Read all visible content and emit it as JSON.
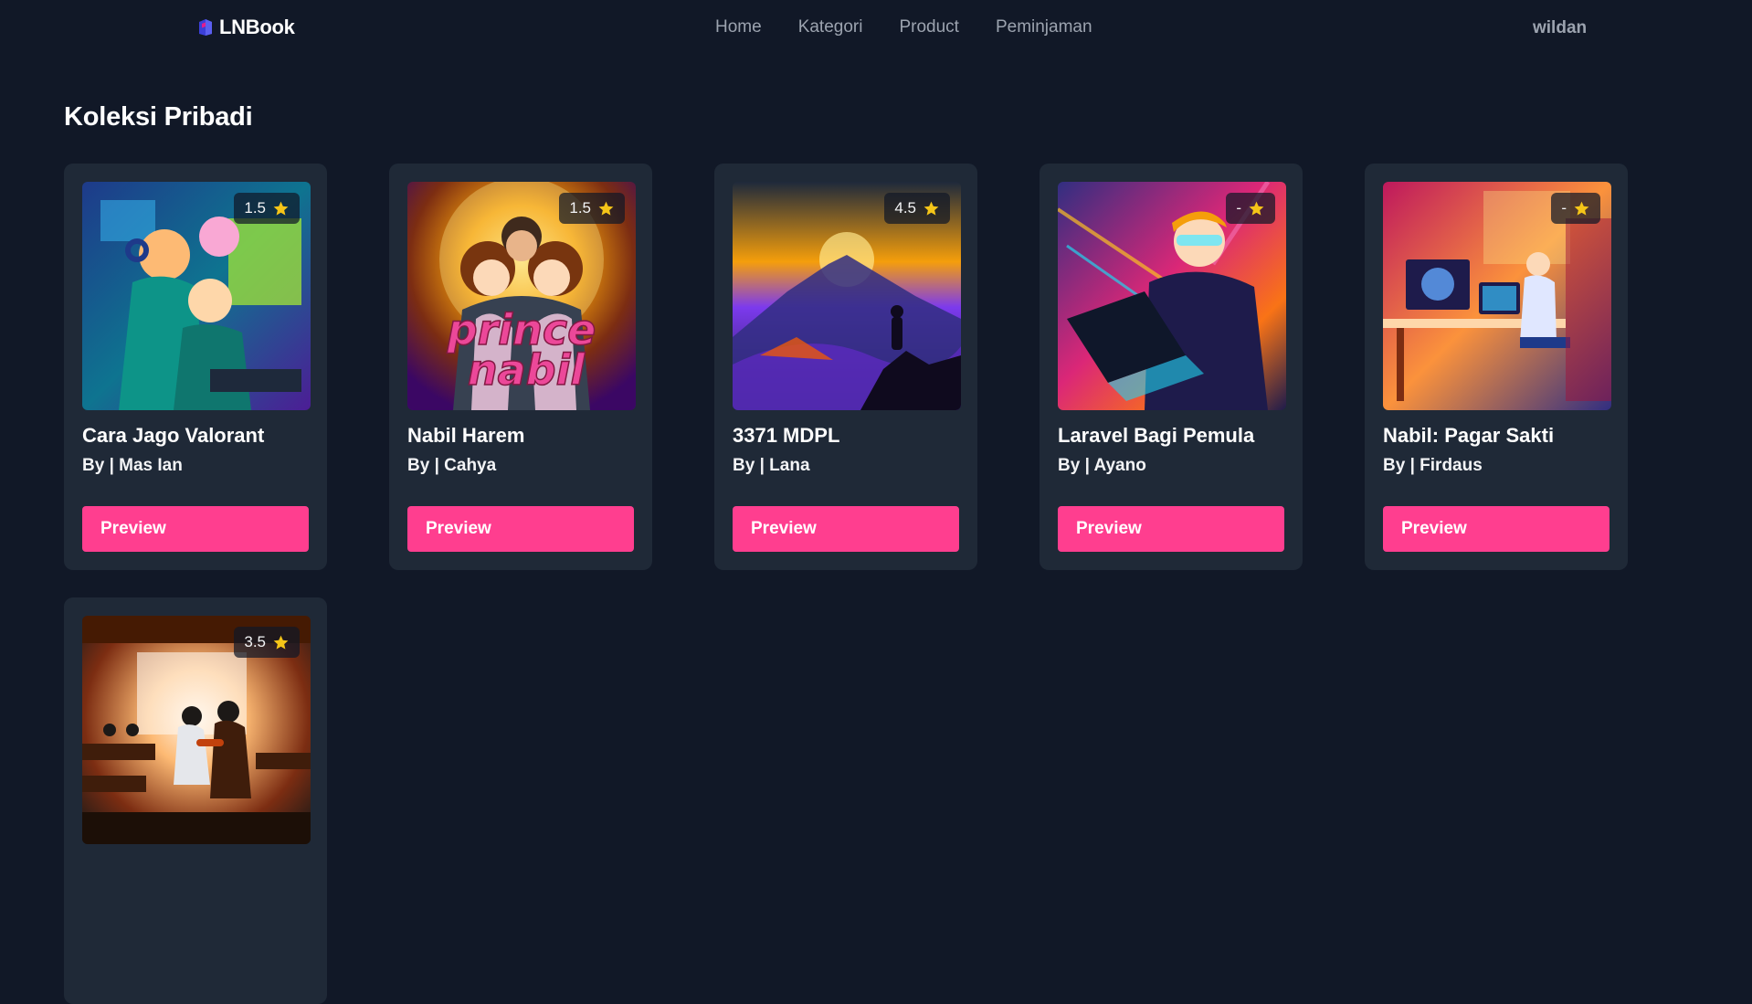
{
  "nav": {
    "brand": "LNBook",
    "links": [
      "Home",
      "Kategori",
      "Product",
      "Peminjaman"
    ],
    "user": "wildan"
  },
  "page": {
    "title": "Koleksi Pribadi"
  },
  "colors": {
    "background": "#111827",
    "card": "#1f2937",
    "accent": "#ff3e8f",
    "star": "#f5c518",
    "muted": "#9ca3af"
  },
  "books": [
    {
      "title": "Cara Jago Valorant",
      "author": "By | Mas Ian",
      "rating": "1.5",
      "button": "Preview",
      "cover": "gamers-at-computers"
    },
    {
      "title": "Nabil Harem",
      "author": "By | Cahya",
      "rating": "1.5",
      "button": "Preview",
      "cover": "romance-prince-nabil",
      "cover_text": [
        "prince",
        "nabil"
      ]
    },
    {
      "title": "3371 MDPL",
      "author": "By | Lana",
      "rating": "4.5",
      "button": "Preview",
      "cover": "mountain-silhouette"
    },
    {
      "title": "Laravel Bagi Pemula",
      "author": "By | Ayano",
      "rating": "-",
      "button": "Preview",
      "cover": "coder-with-laptop"
    },
    {
      "title": "Nabil: Pagar Sakti",
      "author": "By | Firdaus",
      "rating": "-",
      "button": "Preview",
      "cover": "desk-setup-room"
    },
    {
      "title": "",
      "author": "",
      "rating": "3.5",
      "button": "",
      "cover": "classroom-arm-wrestle"
    }
  ]
}
